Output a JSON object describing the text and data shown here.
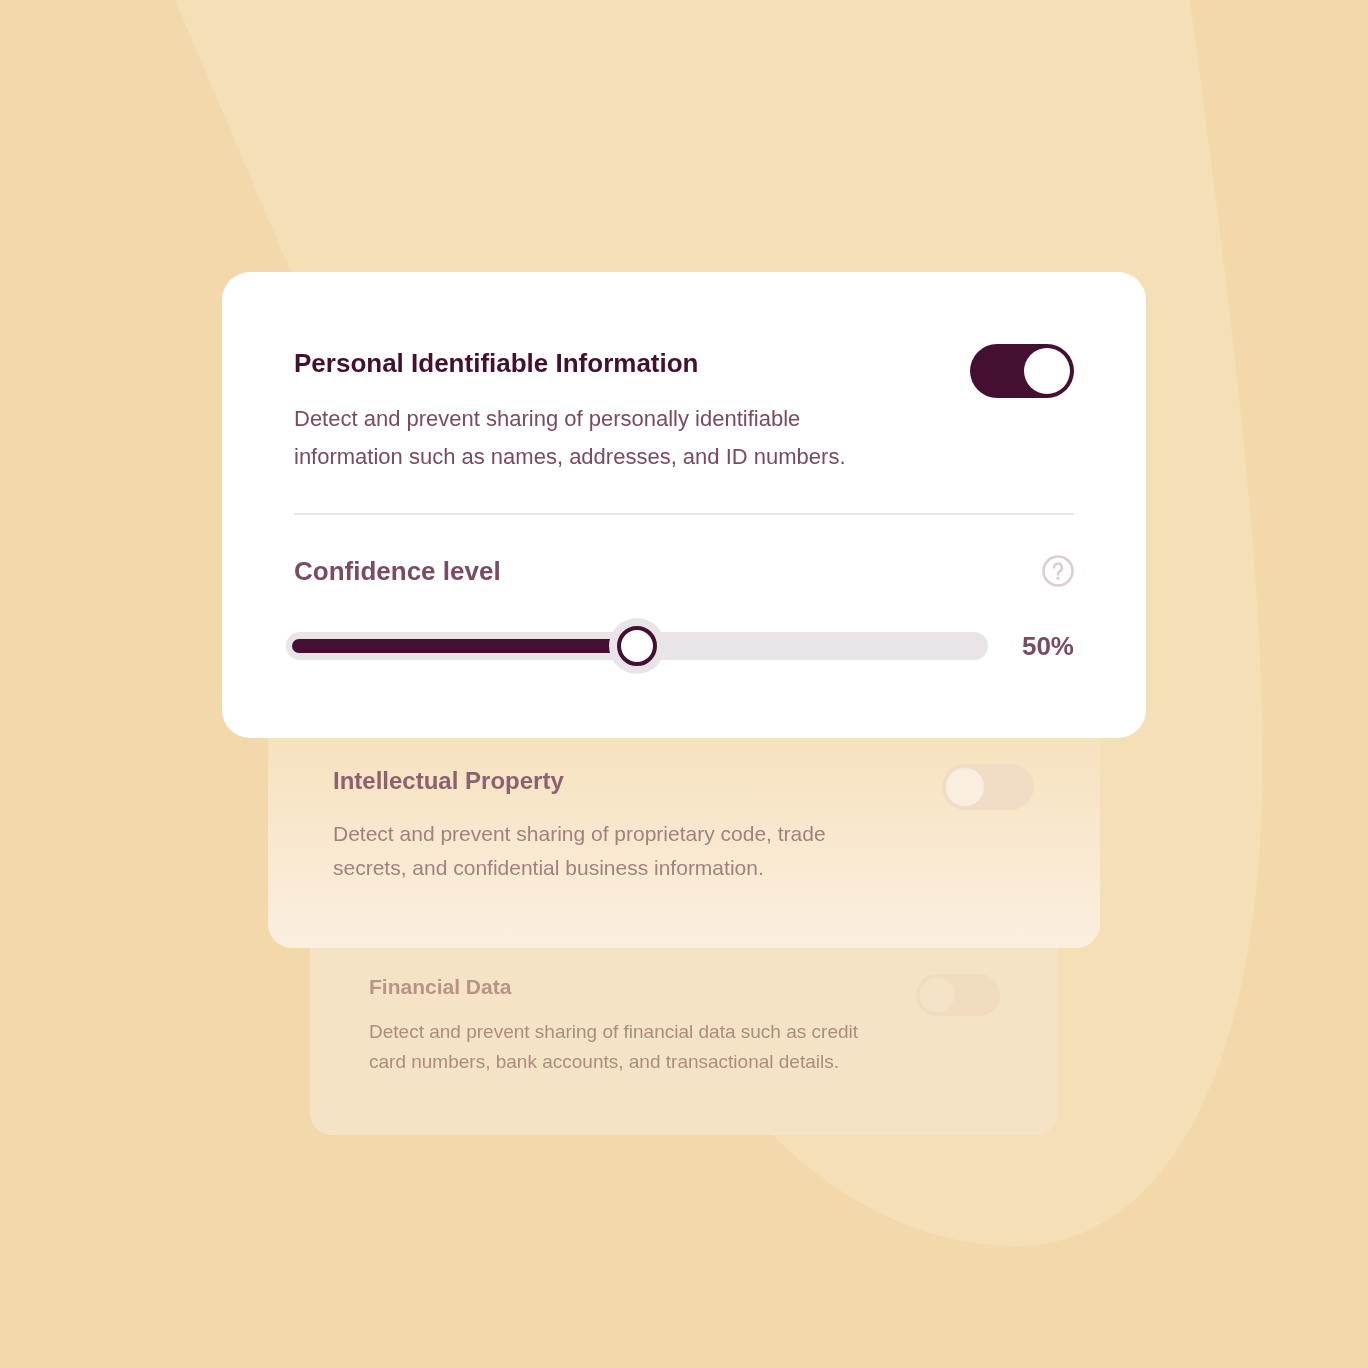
{
  "cards": [
    {
      "title": "Personal Identifiable Information",
      "description": "Detect and prevent sharing of personally identifiable information such as names, addresses, and ID numbers.",
      "on": true,
      "confidence": {
        "label": "Confidence level",
        "level": 0.5,
        "reading": "50%"
      }
    },
    {
      "title": "Intellectual Property",
      "description": "Detect and prevent sharing of proprietary code, trade secrets, and confidential business information.",
      "on": false
    },
    {
      "title": "Financial Data",
      "description": "Detect and prevent sharing of financial data such as credit card numbers, bank accounts, and transactional details.",
      "on": false
    }
  ]
}
